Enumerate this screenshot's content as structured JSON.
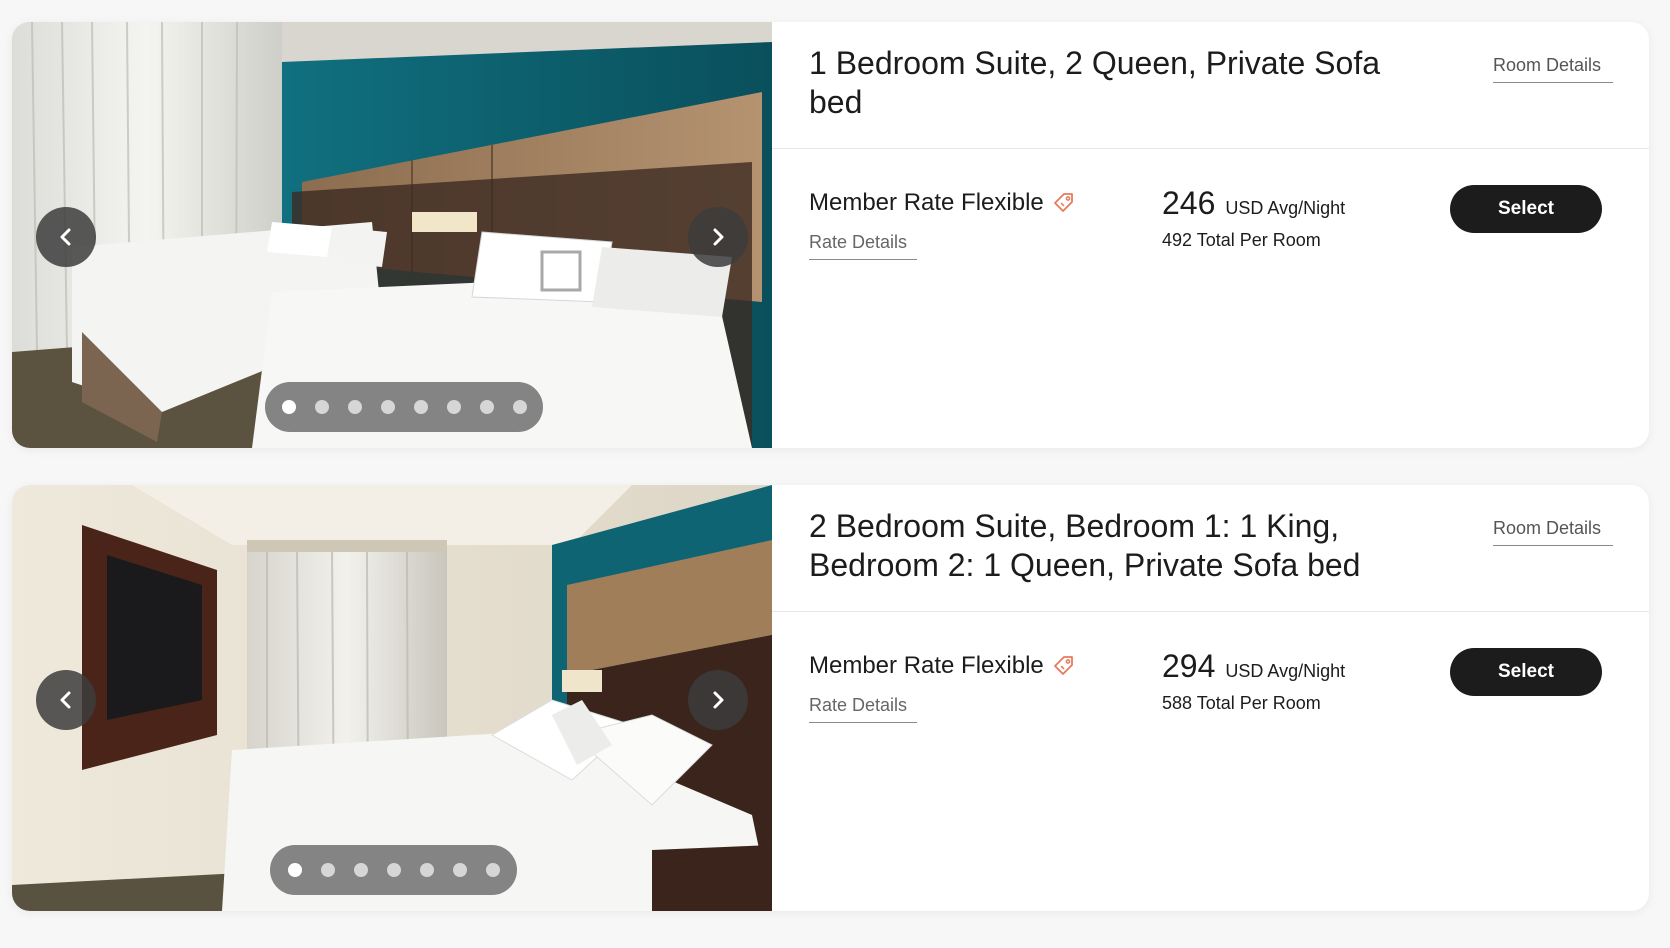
{
  "rooms": [
    {
      "title": "1 Bedroom Suite, 2 Queen, Private Sofa bed",
      "room_details_label": "Room Details",
      "rate_name": "Member Rate Flexible",
      "rate_icon": "tag-icon",
      "rate_details_label": "Rate Details",
      "price": "246",
      "price_unit": "USD Avg/Night",
      "total": "492 Total Per Room",
      "select_label": "Select",
      "carousel": {
        "slide_count": 8,
        "active_index": 0
      }
    },
    {
      "title": "2 Bedroom Suite, Bedroom 1: 1 King, Bedroom 2: 1 Queen, Private Sofa bed",
      "room_details_label": "Room Details",
      "rate_name": "Member Rate Flexible",
      "rate_icon": "tag-icon",
      "rate_details_label": "Rate Details",
      "price": "294",
      "price_unit": "USD Avg/Night",
      "total": "588 Total Per Room",
      "select_label": "Select",
      "carousel": {
        "slide_count": 7,
        "active_index": 0
      }
    }
  ],
  "colors": {
    "accent_tag": "#e8795a",
    "button_bg": "#1c1c1c",
    "teal_wall": "#0f6474"
  }
}
